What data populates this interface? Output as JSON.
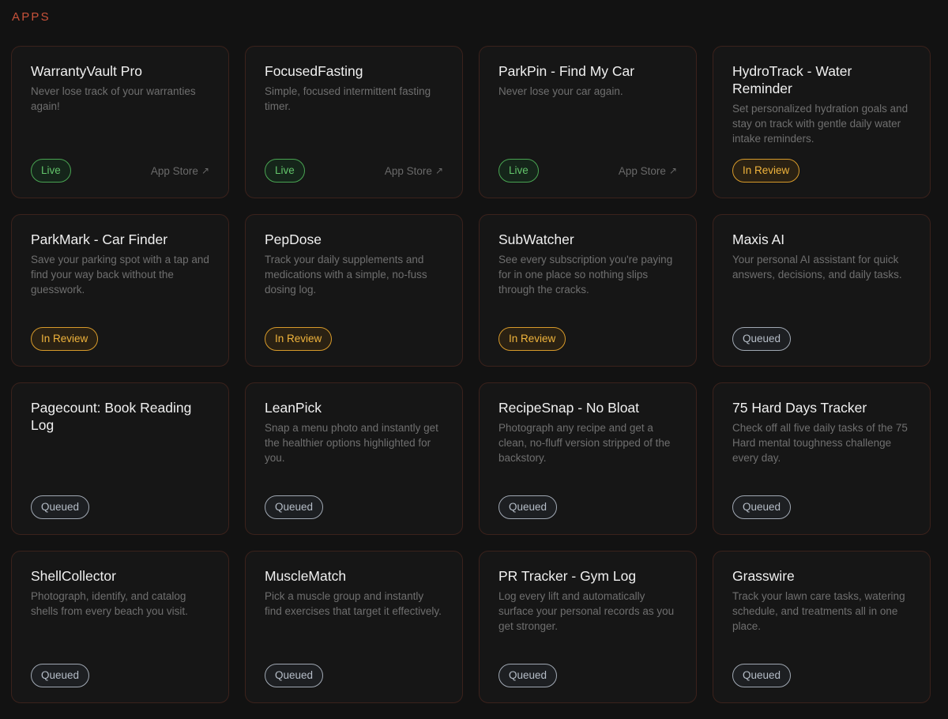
{
  "section": {
    "title": "APPS"
  },
  "colors": {
    "accent": "#c8523a",
    "live": "#62c46a",
    "in_review": "#f0b43c",
    "queued": "#b6bec8",
    "card_border": "#3b221c",
    "background": "#121212"
  },
  "apps": [
    {
      "title": "WarrantyVault Pro",
      "description": "Never lose track of your warranties again!",
      "status": "Live",
      "status_type": "live",
      "store_link": "App Store",
      "store_icon": "arrow-up-right-icon"
    },
    {
      "title": "FocusedFasting",
      "description": "Simple, focused intermittent fasting timer.",
      "status": "Live",
      "status_type": "live",
      "store_link": "App Store",
      "store_icon": "arrow-up-right-icon"
    },
    {
      "title": "ParkPin - Find My Car",
      "description": "Never lose your car again.",
      "status": "Live",
      "status_type": "live",
      "store_link": "App Store",
      "store_icon": "arrow-up-right-icon"
    },
    {
      "title": "HydroTrack - Water Reminder",
      "description": "Set personalized hydration goals and stay on track with gentle daily water intake reminders.",
      "status": "In Review",
      "status_type": "review",
      "store_link": ""
    },
    {
      "title": "ParkMark - Car Finder",
      "description": "Save your parking spot with a tap and find your way back without the guesswork.",
      "status": "In Review",
      "status_type": "review",
      "store_link": ""
    },
    {
      "title": "PepDose",
      "description": "Track your daily supplements and medications with a simple, no-fuss dosing log.",
      "status": "In Review",
      "status_type": "review",
      "store_link": ""
    },
    {
      "title": "SubWatcher",
      "description": "See every subscription you're paying for in one place so nothing slips through the cracks.",
      "status": "In Review",
      "status_type": "review",
      "store_link": ""
    },
    {
      "title": "Maxis AI",
      "description": "Your personal AI assistant for quick answers, decisions, and daily tasks.",
      "status": "Queued",
      "status_type": "queued",
      "store_link": ""
    },
    {
      "title": "Pagecount: Book Reading Log",
      "description": "",
      "status": "Queued",
      "status_type": "queued",
      "store_link": ""
    },
    {
      "title": "LeanPick",
      "description": "Snap a menu photo and instantly get the healthier options highlighted for you.",
      "status": "Queued",
      "status_type": "queued",
      "store_link": ""
    },
    {
      "title": "RecipeSnap - No Bloat",
      "description": "Photograph any recipe and get a clean, no-fluff version stripped of the backstory.",
      "status": "Queued",
      "status_type": "queued",
      "store_link": ""
    },
    {
      "title": "75 Hard Days Tracker",
      "description": "Check off all five daily tasks of the 75 Hard mental toughness challenge every day.",
      "status": "Queued",
      "status_type": "queued",
      "store_link": ""
    },
    {
      "title": "ShellCollector",
      "description": "Photograph, identify, and catalog shells from every beach you visit.",
      "status": "Queued",
      "status_type": "queued",
      "store_link": ""
    },
    {
      "title": "MuscleMatch",
      "description": "Pick a muscle group and instantly find exercises that target it effectively.",
      "status": "Queued",
      "status_type": "queued",
      "store_link": ""
    },
    {
      "title": "PR Tracker - Gym Log",
      "description": "Log every lift and automatically surface your personal records as you get stronger.",
      "status": "Queued",
      "status_type": "queued",
      "store_link": ""
    },
    {
      "title": "Grasswire",
      "description": "Track your lawn care tasks, watering schedule, and treatments all in one place.",
      "status": "Queued",
      "status_type": "queued",
      "store_link": ""
    }
  ]
}
